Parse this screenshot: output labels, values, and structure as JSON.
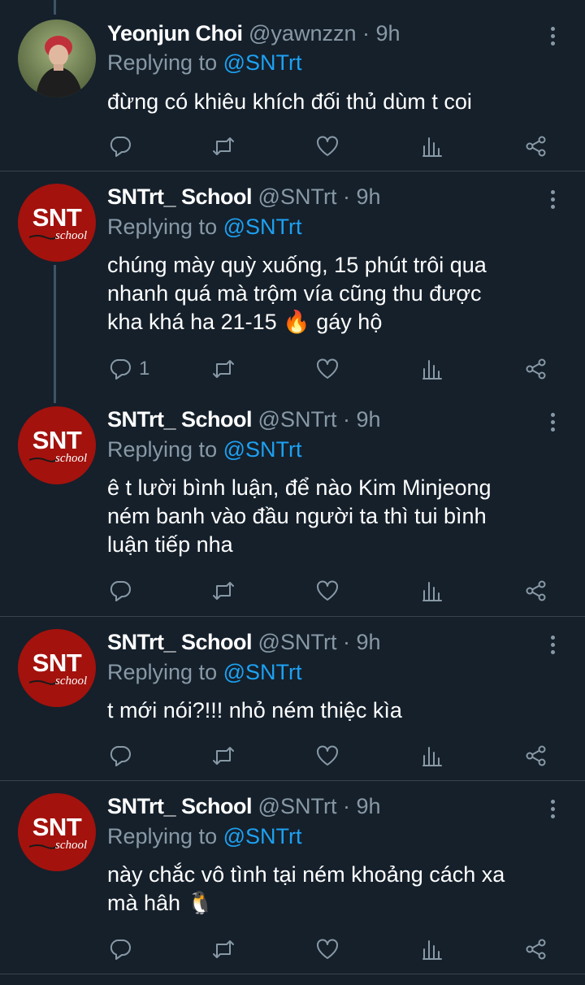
{
  "tweets": [
    {
      "name": "Yeonjun Choi",
      "handle": "@yawnzzn",
      "time": "· 9h",
      "replying_label": "Replying to",
      "replying_to": "@SNTrt",
      "lines": [
        "đừng có khiêu khích đối thủ dùm t coi"
      ],
      "reply_count": ""
    },
    {
      "name": "SNTrt_ School",
      "handle": "@SNTrt",
      "time": "· 9h",
      "replying_label": "Replying to",
      "replying_to": "@SNTrt",
      "lines": [
        "chúng mày quỳ xuống, 15 phút trôi qua",
        "nhanh quá mà trộm vía cũng thu được",
        "kha khá ha 21-15 🔥 gáy hộ"
      ],
      "reply_count": "1"
    },
    {
      "name": "SNTrt_ School",
      "handle": "@SNTrt",
      "time": "· 9h",
      "replying_label": "Replying to",
      "replying_to": "@SNTrt",
      "lines": [
        "ê t lười bình luận, để nào Kim Minjeong",
        "ném banh vào đầu người ta thì tui bình",
        "luận tiếp nha"
      ],
      "reply_count": ""
    },
    {
      "name": "SNTrt_ School",
      "handle": "@SNTrt",
      "time": "· 9h",
      "replying_label": "Replying to",
      "replying_to": "@SNTrt",
      "lines": [
        "t mới nói?!!! nhỏ ném thiệc kìa"
      ],
      "reply_count": ""
    },
    {
      "name": "SNTrt_ School",
      "handle": "@SNTrt",
      "time": "· 9h",
      "replying_label": "Replying to",
      "replying_to": "@SNTrt",
      "lines": [
        "này chắc vô tình tại ném khoảng cách xa",
        "mà hâh 🐧"
      ],
      "reply_count": ""
    }
  ],
  "avatar_text": {
    "logo": "SNT",
    "script": "school"
  },
  "icons": [
    "reply-icon",
    "retweet-icon",
    "like-icon",
    "analytics-icon",
    "share-icon",
    "more-vertical-icon"
  ],
  "colors": {
    "background": "#15202b",
    "secondary": "#8899a6",
    "accent": "#1da1f2",
    "divider": "#38444d",
    "avatar_red": "#a3120d"
  }
}
